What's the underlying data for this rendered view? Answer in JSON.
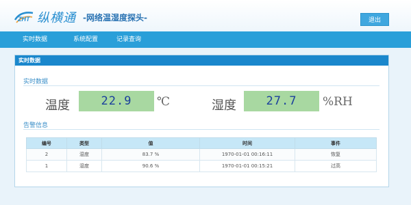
{
  "header": {
    "brand_badge": "ZHT",
    "brand_name": "纵横通",
    "brand_sub": "-网络温湿度探头-",
    "logout_label": "退出"
  },
  "nav": {
    "items": [
      {
        "label": "实时数据"
      },
      {
        "label": "系统配置"
      },
      {
        "label": "记录查询"
      }
    ]
  },
  "panel": {
    "title": "实时数据",
    "realtime_section": "实时数据",
    "alarm_section": "告警信息"
  },
  "readings": {
    "temp_label": "温度",
    "temp_value": "22.9",
    "temp_unit": "℃",
    "hum_label": "湿度",
    "hum_value": "27.7",
    "hum_unit": "%RH"
  },
  "table": {
    "headers": [
      "编号",
      "类型",
      "值",
      "时间",
      "事件"
    ],
    "rows": [
      [
        "2",
        "湿度",
        "83.7 %",
        "1970-01-01 00:16:11",
        "恢复"
      ],
      [
        "1",
        "湿度",
        "90.6 %",
        "1970-01-01 00:15:21",
        "过高"
      ]
    ]
  },
  "colors": {
    "nav_bg": "#2a9fd9",
    "panel_head_bg": "#1a87cc",
    "value_box_bg": "#a8d8a1",
    "value_text": "#1a3f9c"
  }
}
